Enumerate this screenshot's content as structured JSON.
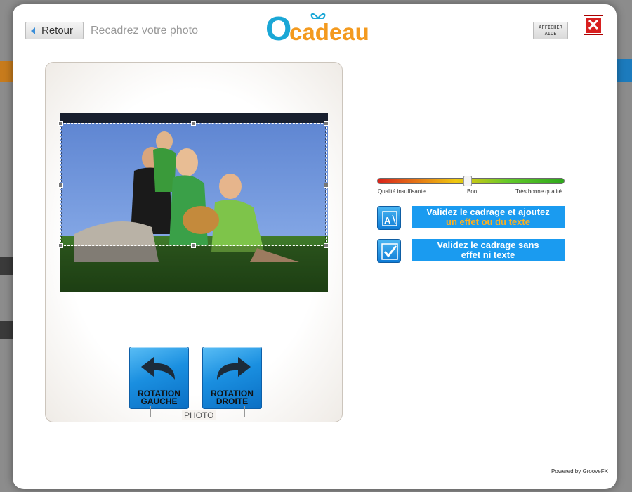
{
  "header": {
    "back_label": "Retour",
    "subtitle": "Recadrez votre photo",
    "logo_o": "O",
    "logo_rest": "cadeau",
    "help_line1": "AFFICHER",
    "help_line2": "AIDE",
    "close_symbol": "✕"
  },
  "editor": {
    "rotate_left_line1": "ROTATION",
    "rotate_left_line2": "GAUCHE",
    "rotate_right_line1": "ROTATION",
    "rotate_right_line2": "DROITE",
    "photo_caption": "PHOTO"
  },
  "quality": {
    "level": 0.46,
    "label_low": "Qualité insuffisante",
    "label_mid": "Bon",
    "label_high": "Très bonne qualité"
  },
  "actions": {
    "effect_line1": "Validez le cadrage et ajoutez",
    "effect_line2": "un effet ou du texte",
    "plain_line1": "Validez le cadrage sans",
    "plain_line2": "effet ni texte"
  },
  "footer": {
    "powered": "Powered by GrooveFX"
  },
  "colors": {
    "accent_blue": "#1a9bf0",
    "logo_blue": "#1aa7d6",
    "logo_orange": "#f39a1f",
    "close_red": "#d82020"
  }
}
